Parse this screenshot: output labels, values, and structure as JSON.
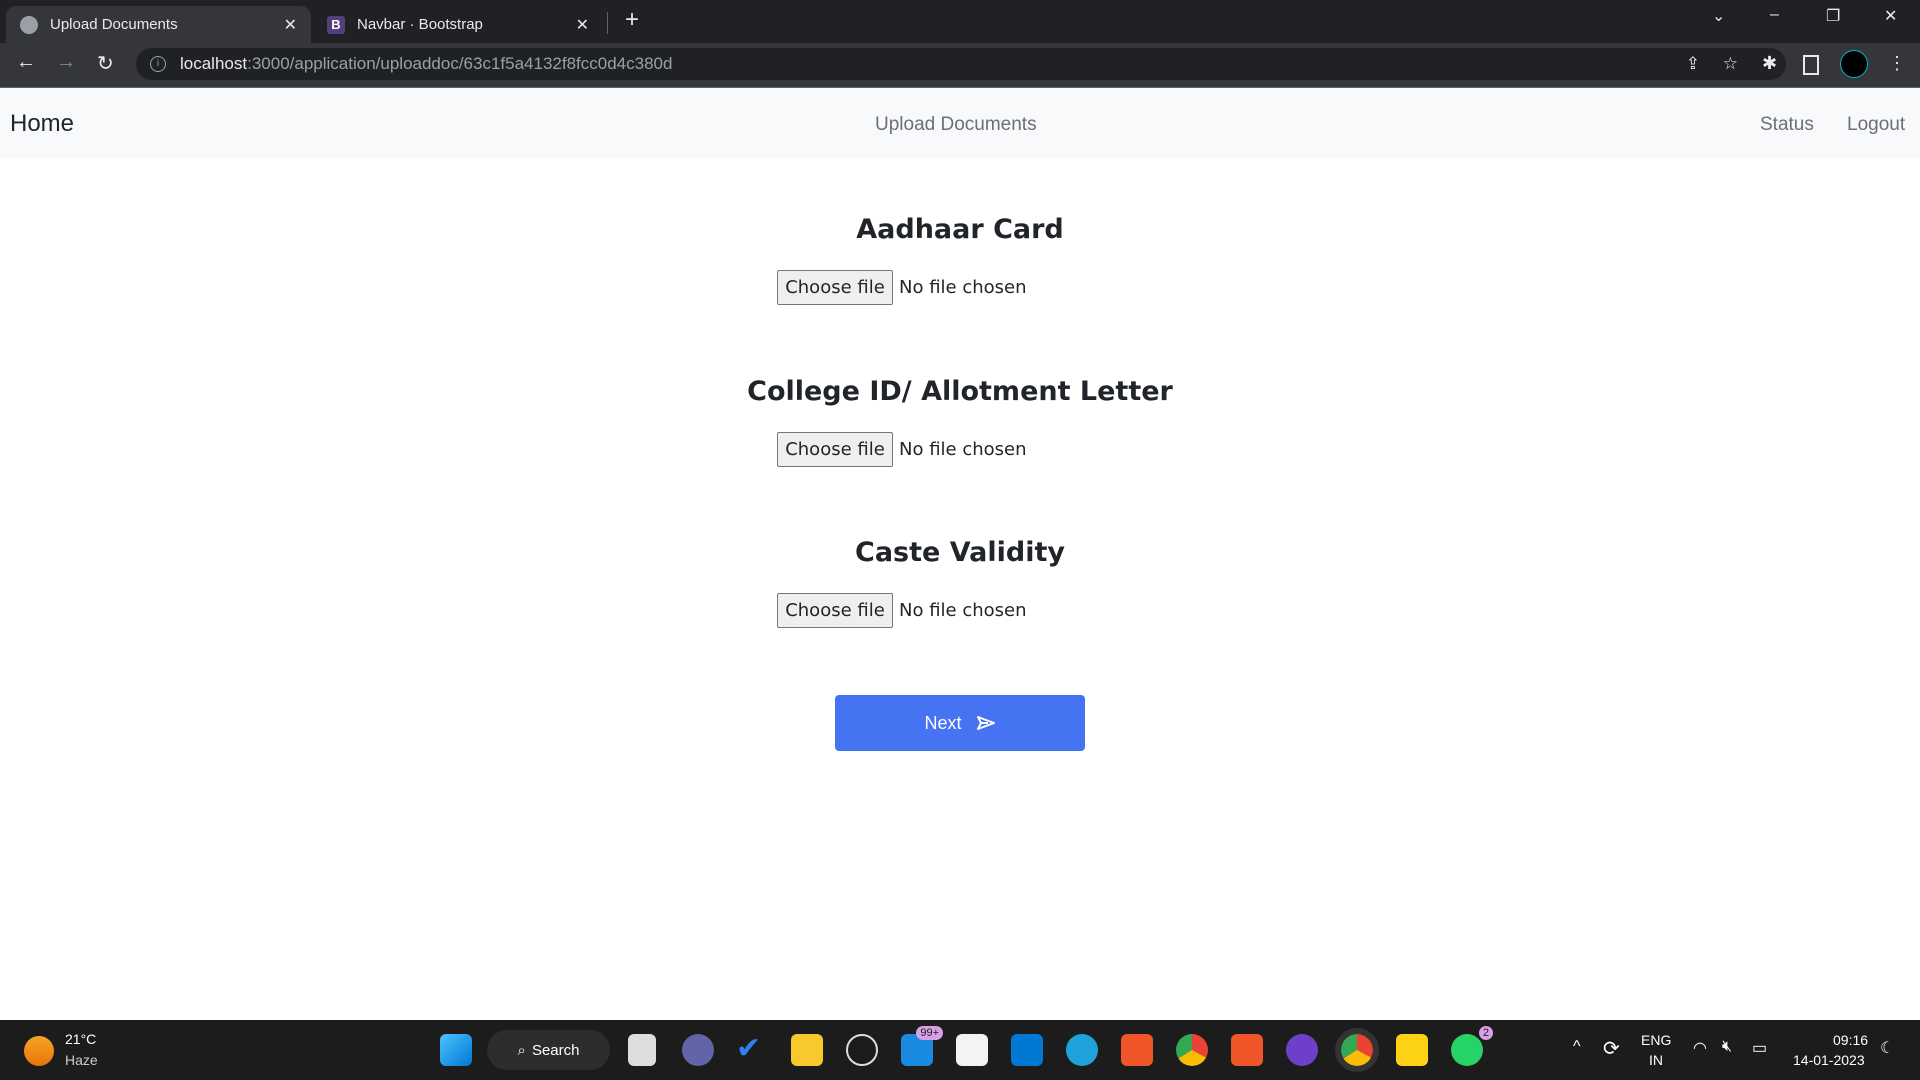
{
  "browser": {
    "tabs": [
      {
        "title": "Upload Documents",
        "icon": "globe-icon",
        "active": true
      },
      {
        "title": "Navbar · Bootstrap",
        "icon": "bootstrap-icon",
        "active": false
      }
    ],
    "url_host": "localhost",
    "url_rest": ":3000/application/uploaddoc/63c1f5a4132f8fcc0d4c380d"
  },
  "navbar": {
    "brand": "Home",
    "center": "Upload Documents",
    "links": [
      "Status",
      "Logout"
    ]
  },
  "sections": [
    {
      "title": "Aadhaar Card",
      "button": "Choose file",
      "status": "No file chosen"
    },
    {
      "title": "College ID/ Allotment Letter",
      "button": "Choose file",
      "status": "No file chosen"
    },
    {
      "title": "Caste Validity",
      "button": "Choose file",
      "status": "No file chosen"
    }
  ],
  "next_button": {
    "label": "Next",
    "color": "#4673f2",
    "icon": "send-icon"
  },
  "taskbar": {
    "weather": {
      "temp": "21°C",
      "condition": "Haze"
    },
    "search": "Search",
    "mail_badge": "99+",
    "whatsapp_badge": "2",
    "lang": "ENG",
    "region": "IN",
    "time": "09:16",
    "date": "14-01-2023"
  }
}
